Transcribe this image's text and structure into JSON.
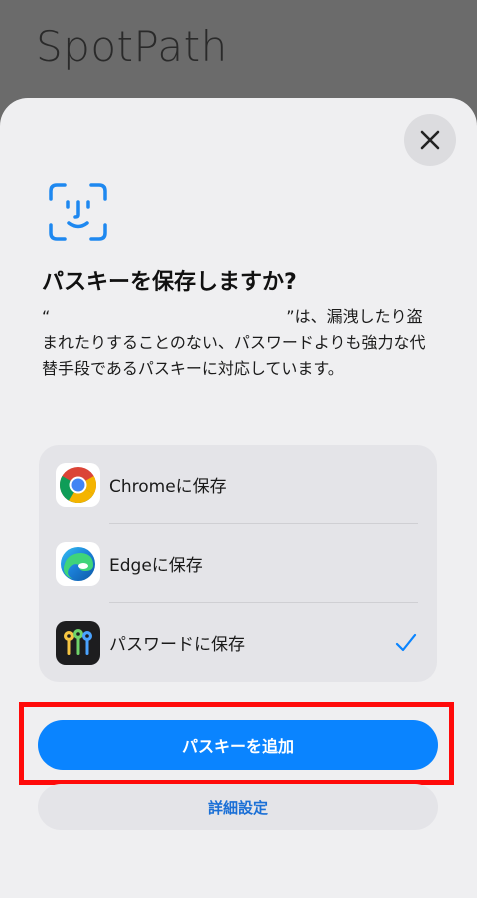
{
  "app": {
    "title": "SpotPath"
  },
  "sheet": {
    "heading": "パスキーを保存しますか?",
    "description_open_quote": "“",
    "description_close_quote": "”",
    "description_rest": "は、漏洩したり盗まれたりすることのない、パスワードよりも強力な代替手段であるパスキーに対応しています。"
  },
  "options": [
    {
      "label": "Chromeに保存",
      "icon": "chrome-icon"
    },
    {
      "label": "Edgeに保存",
      "icon": "edge-icon"
    },
    {
      "label": "パスワードに保存",
      "icon": "passwords-app-icon",
      "selected": true
    }
  ],
  "buttons": {
    "primary": "パスキーを追加",
    "secondary": "詳細設定"
  },
  "colors": {
    "accent": "#0a84ff",
    "highlight": "#ff0a0a"
  }
}
